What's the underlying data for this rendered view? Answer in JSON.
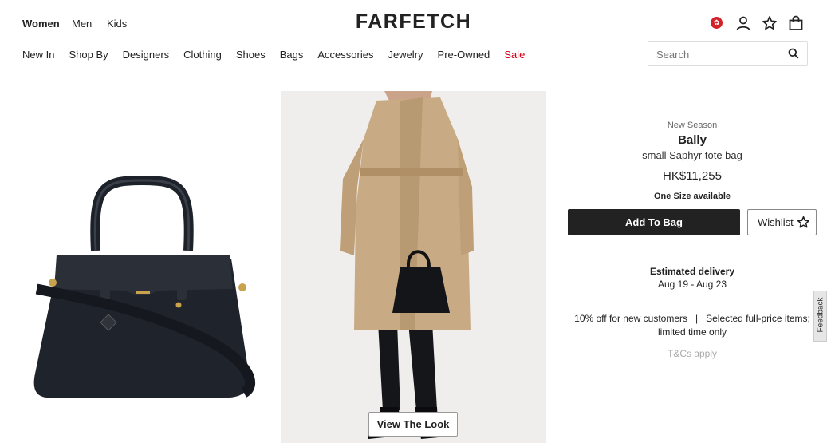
{
  "header": {
    "genders": [
      {
        "label": "Women",
        "active": true
      },
      {
        "label": "Men",
        "active": false
      },
      {
        "label": "Kids",
        "active": false
      }
    ],
    "logo": "FARFETCH",
    "icons": [
      "hong-kong-flag-icon",
      "account-icon",
      "wishlist-star-icon",
      "shopping-bag-icon"
    ]
  },
  "nav": {
    "items": [
      {
        "label": "New In"
      },
      {
        "label": "Shop By"
      },
      {
        "label": "Designers"
      },
      {
        "label": "Clothing"
      },
      {
        "label": "Shoes"
      },
      {
        "label": "Bags"
      },
      {
        "label": "Accessories"
      },
      {
        "label": "Jewelry"
      },
      {
        "label": "Pre-Owned"
      },
      {
        "label": "Sale"
      }
    ],
    "sale_color": "#d0021b"
  },
  "search": {
    "placeholder": "Search",
    "value": ""
  },
  "gallery": {
    "view_the_look": "View The Look"
  },
  "product": {
    "season": "New Season",
    "brand": "Bally",
    "name": "small Saphyr tote bag",
    "price": "HK$11,255",
    "size_note": "One Size available",
    "add_to_bag": "Add To Bag",
    "wishlist": "Wishlist"
  },
  "delivery": {
    "title": "Estimated delivery",
    "dates": "Aug 19 - Aug 23"
  },
  "promo": {
    "text": "10% off for new customers   |   Selected full-price items; limited time only",
    "tcs": "T&Cs apply"
  },
  "feedback": {
    "label": "Feedback"
  },
  "colors": {
    "primary_button": "#222222",
    "sale_red": "#d0021b",
    "gallery_bg": "#efeeec"
  }
}
